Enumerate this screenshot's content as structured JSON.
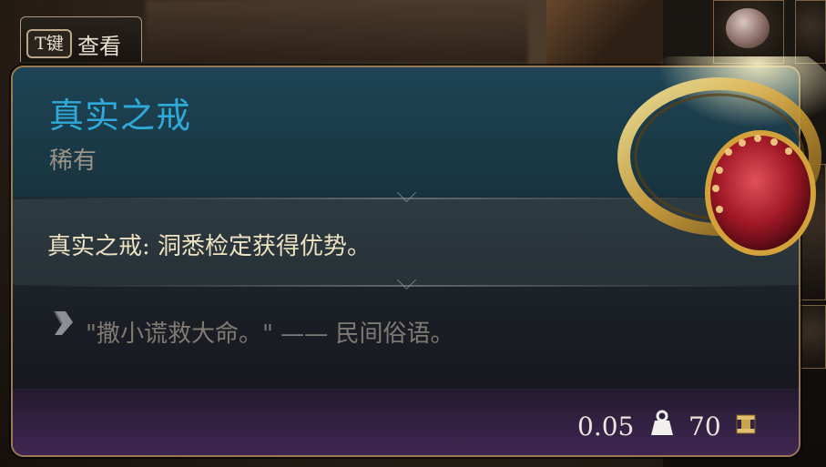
{
  "hint": {
    "key": "T键",
    "label": "查看"
  },
  "item": {
    "name": "真实之戒",
    "rarity": "稀有",
    "effect": "真实之戒: 洞悉检定获得优势。",
    "flavor": "\"撒小谎救大命。\" —— 民间俗语。",
    "weight": "0.05",
    "price": "70"
  },
  "icons": {
    "weight": "weight-icon",
    "currency": "gold-coin-icon",
    "flavor": "quill-icon",
    "item_art": "ring-of-truth-icon",
    "slot_item": "brain-icon"
  },
  "colors": {
    "title": "#2fa9d9",
    "rarity": "#9b9488",
    "effect_text": "#ece2c2",
    "flavor_text": "#807a74",
    "border": "#9a7a52"
  }
}
